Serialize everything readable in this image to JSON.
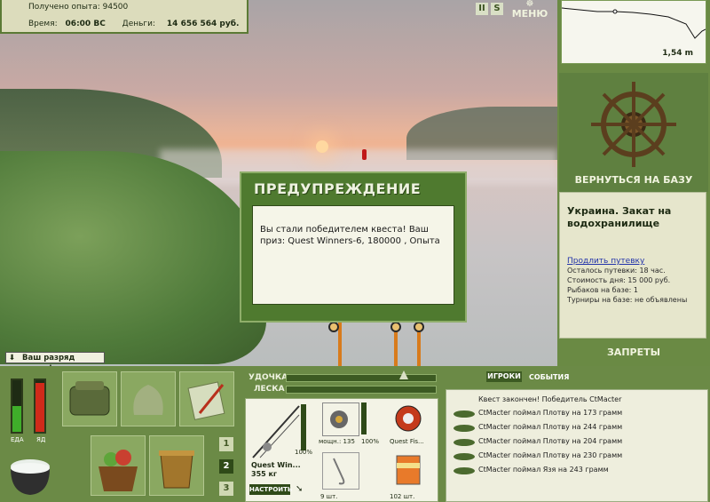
{
  "stats": {
    "exp_label": "Получено опыта:",
    "exp_value": "94500",
    "time_label": "Время:",
    "time_value": "06:00 ВС",
    "money_label": "Деньги:",
    "money_value": "14 656 564 руб."
  },
  "top": {
    "pause_symbol": "II",
    "sound_symbol": "S",
    "menu_label": "МЕНЮ"
  },
  "depth": {
    "value": "1,54 m"
  },
  "right": {
    "back_label": "ВЕРНУТЬСЯ НА БАЗУ",
    "place": "Украина. Закат на водохранилище",
    "extend_link": "Продлить путевку",
    "lines": [
      "Осталось путевки: 18 час.",
      "Стоимость дня: 15 000 руб.",
      "Рыбаков на базе: 1",
      "Турниры на базе: не объявлены"
    ],
    "bans_label": "ЗАПРЕТЫ"
  },
  "dialog": {
    "title": "ПРЕДУПРЕЖДЕНИЕ",
    "message": "Вы стали победителем квеста! Ваш приз: Quest Winners-6, 180000 , Опыта"
  },
  "toast": {
    "text": "Ваш разряд вырос!"
  },
  "meters": {
    "food_label": "ЕДА",
    "poison_label": "ЯД",
    "food_level": 0.5,
    "poison_level": 0.95
  },
  "pages": [
    "1",
    "2",
    "3"
  ],
  "tackle": {
    "rod_label": "УДОЧКА",
    "line_label": "ЛЕСКА",
    "rod_name": "Quest Win...",
    "rod_weight": "355 кг",
    "rod_percent": "100%",
    "reel_power": "мощн.: 135",
    "reel_percent": "100%",
    "lure_name": "Quest Fis...",
    "hooks_count": "9 шт.",
    "bait_count": "102 шт.",
    "setup_button": "НАСТРОИТЬ"
  },
  "log": {
    "tab_players": "ИГРОКИ",
    "tab_events": "СОБЫТИЯ",
    "header": "Квест закончен! Победитель CtMacter",
    "entries": [
      "CtMacter поймал Плотву на 173 грамм",
      "CtMacter поймал Плотву на 244 грамм",
      "CtMacter поймал Плотву на 204 грамм",
      "CtMacter поймал Плотву на 230 грамм",
      "CtMacter поймал Язя на 243 грамм"
    ]
  },
  "colors": {
    "panel_green": "#6b8a46",
    "dialog_green": "#4f7a2f",
    "food_bar": "#3fae2a",
    "poison_bar": "#d02a1a"
  }
}
